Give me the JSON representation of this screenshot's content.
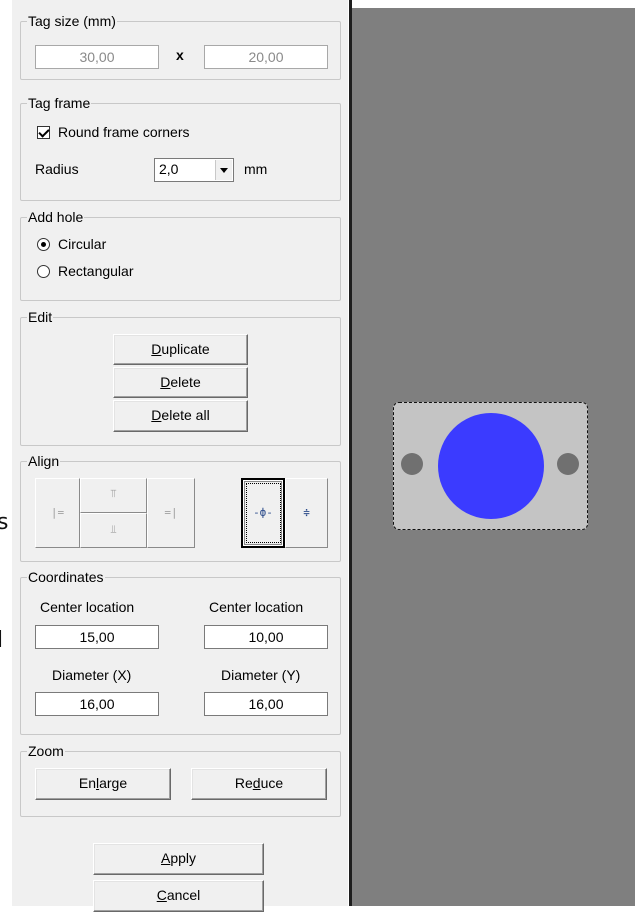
{
  "offscreen_stubs": [
    "s",
    "l"
  ],
  "tag_size": {
    "legend": "Tag size (mm)",
    "width": "30,00",
    "separator": "x",
    "height": "20,00"
  },
  "tag_frame": {
    "legend": "Tag frame",
    "round_corners_label": "Round frame corners",
    "round_corners_checked": true,
    "radius_label": "Radius",
    "radius_value": "2,0",
    "radius_unit": "mm"
  },
  "add_hole": {
    "legend": "Add hole",
    "options": [
      "Circular",
      "Rectangular"
    ],
    "selected": "Circular"
  },
  "edit": {
    "legend": "Edit",
    "duplicate_pre": "",
    "duplicate_u": "D",
    "duplicate_post": "uplicate",
    "delete_pre": "",
    "delete_u": "D",
    "delete_post": "elete",
    "delete_all_pre": "",
    "delete_all_u": "D",
    "delete_all_post": "elete all"
  },
  "align": {
    "legend": "Align",
    "buttons": [
      "align-left-icon",
      "align-top-icon",
      "align-bottom-icon",
      "align-right-icon",
      "center-horizontal-icon",
      "center-vertical-icon"
    ]
  },
  "coordinates": {
    "legend": "Coordinates",
    "center_x_label": "Center location",
    "center_x_value": "15,00",
    "center_y_label": "Center location",
    "center_y_value": "10,00",
    "diameter_x_label": "Diameter (X)",
    "diameter_x_value": "16,00",
    "diameter_y_label": "Diameter (Y)",
    "diameter_y_value": "16,00"
  },
  "zoom": {
    "legend": "Zoom",
    "enlarge_pre": "En",
    "enlarge_u": "l",
    "enlarge_post": "arge",
    "reduce_pre": "Re",
    "reduce_u": "d",
    "reduce_post": "uce"
  },
  "actions": {
    "apply_pre": "",
    "apply_u": "A",
    "apply_post": "pply",
    "cancel_pre": "",
    "cancel_u": "C",
    "cancel_post": "ancel"
  },
  "colors": {
    "canvas": "#7f7f7f",
    "tag": "#c4c4c4",
    "hole_selected": "#3b3bff",
    "hole_other": "#707070"
  }
}
